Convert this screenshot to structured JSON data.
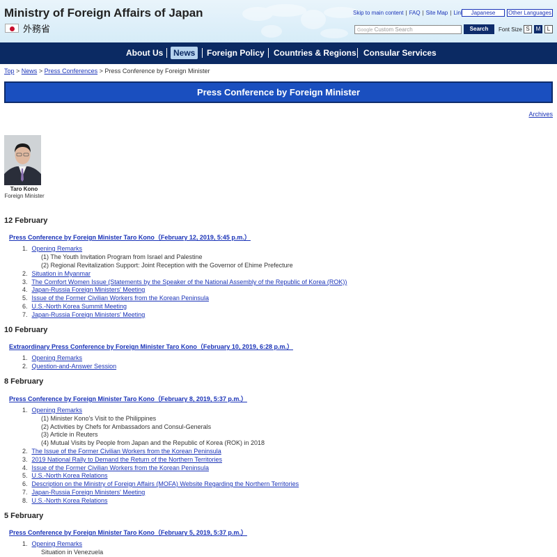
{
  "header": {
    "site_title": "Ministry of Foreign Affairs of Japan",
    "logo_jp": "外務省",
    "util_links": [
      "Skip to main content",
      "FAQ",
      "Site Map",
      "Links"
    ],
    "lang_japanese": "Japanese",
    "lang_other": "Other Languages",
    "search_brand": "Google",
    "search_placeholder": "Custom Search",
    "search_button": "Search",
    "font_size_label": "Font Size",
    "font_sizes": [
      "S",
      "M",
      "L"
    ],
    "font_size_selected": "M"
  },
  "nav": {
    "items": [
      "About Us",
      "News",
      "Foreign Policy",
      "Countries & Regions",
      "Consular Services"
    ],
    "active": "News"
  },
  "breadcrumb": {
    "items": [
      "Top",
      "News",
      "Press Conferences"
    ],
    "current": "Press Conference by Foreign Minister"
  },
  "page_title": "Press Conference by Foreign Minister",
  "archives_link": "Archives",
  "minister": {
    "name": "Taro Kono",
    "title": "Foreign Minister"
  },
  "sections": [
    {
      "date": "12 February",
      "conference": "Press Conference by Foreign Minister Taro Kono（February 12, 2019, 5:45 p.m.）",
      "items": [
        {
          "num": "1.",
          "label": "Opening Remarks",
          "sub": [
            "(1) The Youth Invitation Program from Israel and Palestine",
            "(2) Regional Revitalization Support: Joint Reception with the Governor of Ehime Prefecture"
          ]
        },
        {
          "num": "2.",
          "label": "Situation in Myanmar"
        },
        {
          "num": "3.",
          "label": "The Comfort Women Issue (Statements by the Speaker of the National Assembly of the Republic of Korea (ROK))"
        },
        {
          "num": "4.",
          "label": "Japan-Russia Foreign Ministers' Meeting"
        },
        {
          "num": "5.",
          "label": "Issue of the Former Civilian Workers from the Korean Peninsula"
        },
        {
          "num": "6.",
          "label": "U.S.-North Korea Summit Meeting"
        },
        {
          "num": "7.",
          "label": "Japan-Russia Foreign Ministers' Meeting"
        }
      ]
    },
    {
      "date": "10 February",
      "conference": "Extraordinary Press Conference by Foreign Minister Taro Kono（February 10, 2019, 6:28 p.m.）",
      "items": [
        {
          "num": "1.",
          "label": "Opening Remarks"
        },
        {
          "num": "2.",
          "label": "Question-and-Answer Session"
        }
      ]
    },
    {
      "date": "8 February",
      "conference": "Press Conference by Foreign Minister Taro Kono（February 8, 2019, 5:37 p.m.）",
      "items": [
        {
          "num": "1.",
          "label": "Opening Remarks",
          "sub": [
            "(1) Minister Kono's Visit to the Philippines",
            "(2) Activities by Chefs for Ambassadors and Consul-Generals",
            "(3) Article in Reuters",
            "(4) Mutual Visits by People from Japan and the Republic of Korea (ROK) in 2018"
          ]
        },
        {
          "num": "2.",
          "label": "The Issue of the Former Civilian Workers from the Korean Peninsula"
        },
        {
          "num": "3.",
          "label": "2019 National Rally to Demand the Return of the Northern Territories"
        },
        {
          "num": "4.",
          "label": "Issue of the Former Civilian Workers from the Korean Peninsula"
        },
        {
          "num": "5.",
          "label": "U.S.-North Korea Relations"
        },
        {
          "num": "6.",
          "label": "Description on the Ministry of Foreign Affairs (MOFA) Website Regarding the Northern Territories"
        },
        {
          "num": "7.",
          "label": "Japan-Russia Foreign Ministers' Meeting"
        },
        {
          "num": "8.",
          "label": "U.S.-North Korea Relations"
        }
      ]
    },
    {
      "date": "5 February",
      "conference": "Press Conference by Foreign Minister Taro Kono（February 5, 2019, 5:37 p.m.）",
      "items": [
        {
          "num": "1.",
          "label": "Opening Remarks",
          "sub": [
            "Situation in Venezuela"
          ]
        }
      ]
    }
  ]
}
